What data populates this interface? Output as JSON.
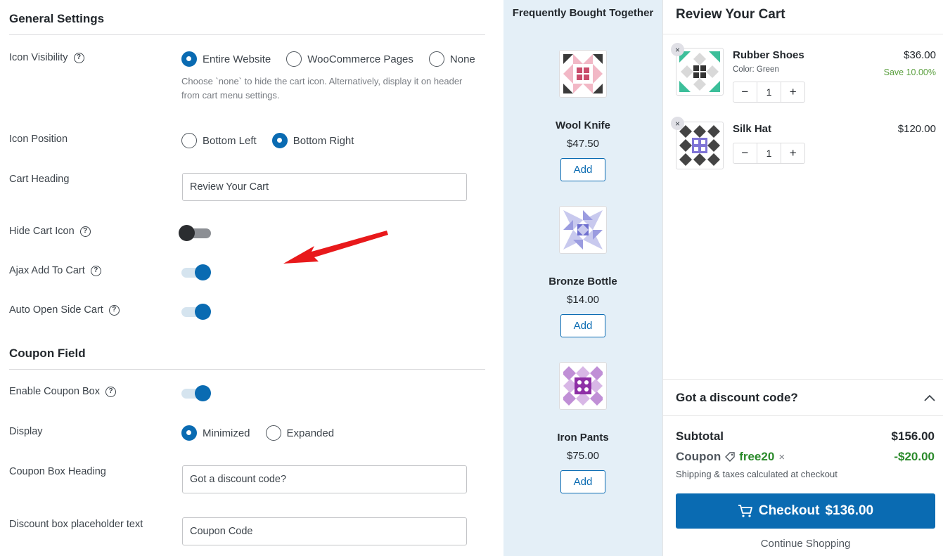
{
  "settings": {
    "general_title": "General Settings",
    "coupon_title": "Coupon Field",
    "icon_visibility": {
      "label": "Icon Visibility",
      "options": [
        "Entire Website",
        "WooCommerce Pages",
        "None"
      ],
      "selected": "Entire Website",
      "help": "Choose `none` to hide the cart icon. Alternatively, display it on header from cart menu settings."
    },
    "icon_position": {
      "label": "Icon Position",
      "options": [
        "Bottom Left",
        "Bottom Right"
      ],
      "selected": "Bottom Right"
    },
    "cart_heading": {
      "label": "Cart Heading",
      "value": "Review Your Cart"
    },
    "hide_cart_icon": {
      "label": "Hide Cart Icon",
      "on": false
    },
    "ajax_add_to_cart": {
      "label": "Ajax Add To Cart",
      "on": true
    },
    "auto_open_side_cart": {
      "label": "Auto Open Side Cart",
      "on": true
    },
    "enable_coupon_box": {
      "label": "Enable Coupon Box",
      "on": true
    },
    "display": {
      "label": "Display",
      "options": [
        "Minimized",
        "Expanded"
      ],
      "selected": "Minimized"
    },
    "coupon_box_heading": {
      "label": "Coupon Box Heading",
      "value": "Got a discount code?"
    },
    "discount_placeholder": {
      "label": "Discount box placeholder text",
      "value": "Coupon Code"
    },
    "help_glyph": "?"
  },
  "fbt": {
    "title": "Frequently Bought Together",
    "add_label": "Add",
    "items": [
      {
        "name": "Wool Knife",
        "price": "$47.50"
      },
      {
        "name": "Bronze Bottle",
        "price": "$14.00"
      },
      {
        "name": "Iron Pants",
        "price": "$75.00"
      }
    ]
  },
  "cart": {
    "heading": "Review Your Cart",
    "items": [
      {
        "name": "Rubber Shoes",
        "meta_label": "Color:",
        "meta_value": "Green",
        "price": "$36.00",
        "save": "Save 10.00%",
        "qty": "1"
      },
      {
        "name": "Silk Hat",
        "price": "$120.00",
        "qty": "1"
      }
    ],
    "discount_label": "Got a discount code?",
    "subtotal_label": "Subtotal",
    "subtotal_value": "$156.00",
    "coupon_label": "Coupon",
    "coupon_code": "free20",
    "coupon_value": "-$20.00",
    "shipping_note": "Shipping & taxes calculated at checkout",
    "checkout_label": "Checkout",
    "checkout_total": "$136.00",
    "continue_label": "Continue Shopping",
    "minus": "−",
    "plus": "+",
    "remove": "×"
  },
  "colors": {
    "primary": "#0a6bb2",
    "fbt_bg": "#e4eff7",
    "save_green": "#5a9f3e",
    "coupon_green": "#2a8a2a",
    "annotation_red": "#e8191b"
  },
  "icons": {
    "help": "question-circle-icon",
    "cart": "shopping-cart-icon",
    "tag": "tag-icon",
    "chevron": "chevron-up-icon"
  }
}
